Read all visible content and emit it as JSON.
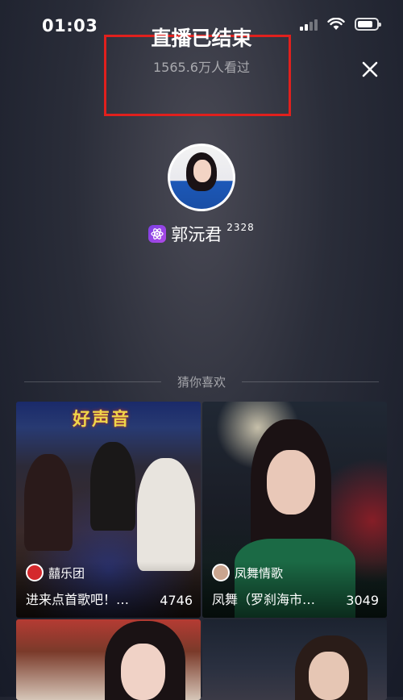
{
  "status_bar": {
    "time": "01:03"
  },
  "header": {
    "title": "直播已结束",
    "viewers": "1565.6万人看过"
  },
  "streamer": {
    "name": "郭沅君",
    "level": "2328"
  },
  "recommend": {
    "label": "猜你喜欢",
    "cards": [
      {
        "author": "囍乐团",
        "caption": "进来点首歌吧！…",
        "count": "4746",
        "banner": "好声音"
      },
      {
        "author": "凤舞情歌",
        "caption": "凤舞（罗刹海市…",
        "count": "3049"
      },
      {},
      {}
    ]
  },
  "colors": {
    "highlight_border": "#e0201d",
    "badge_purple": "#7b3fe4"
  },
  "icons": [
    "close-icon",
    "signal-icon",
    "wifi-icon",
    "battery-icon",
    "atom-badge-icon"
  ]
}
